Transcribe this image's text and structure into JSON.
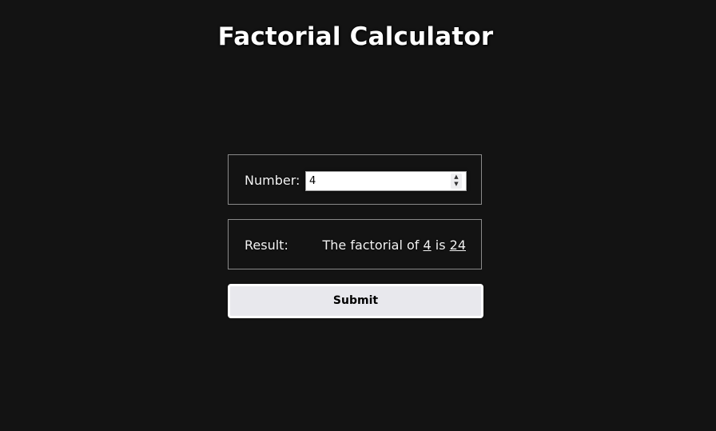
{
  "page": {
    "title": "Factorial Calculator"
  },
  "number_panel": {
    "label": "Number:",
    "input_value": "4"
  },
  "result_panel": {
    "label": "Result:",
    "text_prefix": "The factorial of",
    "input_number": "4",
    "text_middle": "is",
    "factorial_value": "24"
  },
  "submit": {
    "label": "Submit"
  },
  "icons": {
    "spinner_up": "chevron-up",
    "spinner_down": "chevron-down"
  },
  "colors": {
    "background": "#131313",
    "text": "#ffffff",
    "button_bg": "#e8e8ed",
    "panel_border": "#8a8a8a"
  }
}
